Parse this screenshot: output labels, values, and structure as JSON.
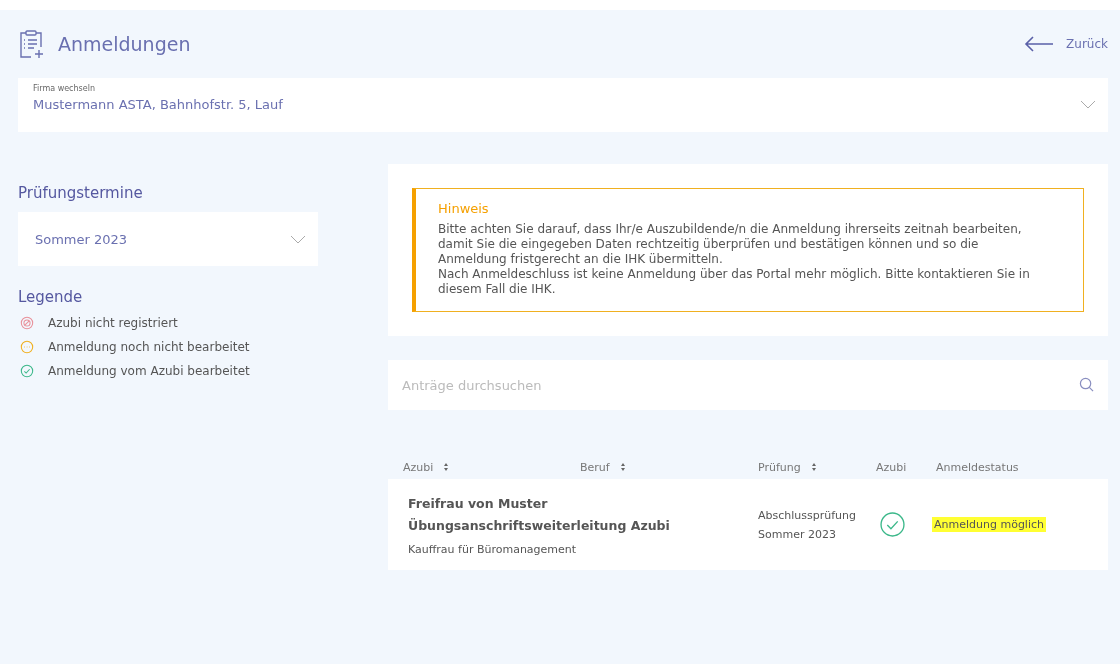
{
  "header": {
    "title": "Anmeldungen",
    "back_label": "Zurück"
  },
  "company_select": {
    "label": "Firma wechseln",
    "value": "Mustermann ASTA, Bahnhofstr. 5, Lauf"
  },
  "exam_dates": {
    "title": "Prüfungstermine",
    "value": "Sommer 2023"
  },
  "legend": {
    "title": "Legende",
    "items": [
      {
        "kind": "not_registered",
        "label": "Azubi nicht registriert"
      },
      {
        "kind": "pending",
        "label": "Anmeldung noch nicht bearbeitet"
      },
      {
        "kind": "done",
        "label": "Anmeldung vom Azubi bearbeitet"
      }
    ]
  },
  "notice": {
    "title": "Hinweis",
    "paragraphs": [
      "Bitte achten Sie darauf, dass Ihr/e Auszubildende/n die Anmeldung ihrerseits zeitnah bearbeiten, damit Sie die eingegeben Daten rechtzeitig überprüfen und bestätigen können und so die Anmeldung fristgerecht an die IHK übermitteln.",
      "Nach Anmeldeschluss ist keine Anmeldung über das Portal mehr möglich. Bitte kontaktieren Sie in diesem Fall die IHK."
    ]
  },
  "search": {
    "placeholder": "Anträge durchsuchen"
  },
  "table": {
    "columns": [
      {
        "label": "Azubi",
        "sortable": true
      },
      {
        "label": "Beruf",
        "sortable": true
      },
      {
        "label": "Prüfung",
        "sortable": true
      },
      {
        "label": "Azubi",
        "sortable": false
      },
      {
        "label": "Anmeldestatus",
        "sortable": false
      }
    ],
    "rows": [
      {
        "name_lines": [
          "Freifrau von Muster",
          "Übungsanschriftsweiterleitung Azubi"
        ],
        "occupation": "Kauffrau für Büromanagement",
        "exam_lines": [
          "Abschlussprüfung",
          "Sommer 2023"
        ],
        "kind": "done",
        "status": "Anmeldung möglich",
        "highlighted": true
      }
    ]
  }
}
